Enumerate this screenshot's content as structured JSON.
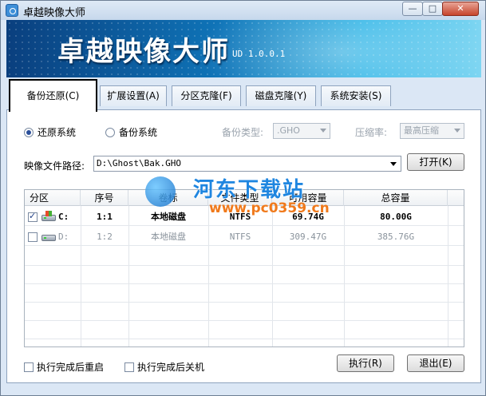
{
  "window": {
    "title": "卓越映像大师",
    "min_label": "—",
    "max_label": "□",
    "close_label": "✕"
  },
  "banner": {
    "title": "卓越映像大师",
    "version": "UD 1.0.0.1"
  },
  "tabs": [
    {
      "label": "备份还原(C)",
      "active": true
    },
    {
      "label": "扩展设置(A)",
      "active": false
    },
    {
      "label": "分区克隆(F)",
      "active": false
    },
    {
      "label": "磁盘克隆(Y)",
      "active": false
    },
    {
      "label": "系统安装(S)",
      "active": false
    }
  ],
  "mode": {
    "restore_label": "还原系统",
    "backup_label": "备份系统",
    "selected": "restore"
  },
  "backup_type": {
    "label": "备份类型:",
    "value": ".GHO"
  },
  "compression": {
    "label": "压缩率:",
    "value": "最高压缩"
  },
  "image_path": {
    "label": "映像文件路径:",
    "value": "D:\\Ghost\\Bak.GHO",
    "open_button": "打开(K)"
  },
  "table": {
    "headers": [
      "分区",
      "序号",
      "卷标",
      "文件类型",
      "可用容量",
      "总容量"
    ],
    "rows": [
      {
        "drive": "C:",
        "index": "1:1",
        "label": "本地磁盘",
        "fs": "NTFS",
        "free": "69.74G",
        "total": "80.00G",
        "checked": true,
        "system": true
      },
      {
        "drive": "D:",
        "index": "1:2",
        "label": "本地磁盘",
        "fs": "NTFS",
        "free": "309.47G",
        "total": "385.76G",
        "checked": false,
        "system": false
      }
    ]
  },
  "options": {
    "reboot_label": "执行完成后重启",
    "shutdown_label": "执行完成后关机"
  },
  "actions": {
    "execute_label": "执行(R)",
    "exit_label": "退出(E)"
  },
  "watermark": {
    "text": "河东下载站",
    "url": "www.pc0359.cn"
  },
  "colors": {
    "window_frame": "#dbe7f5",
    "banner_dark": "#0a3f7e",
    "banner_light": "#7fd6f2",
    "watermark_blue": "#1f86e0",
    "watermark_orange": "#f07a1c"
  }
}
